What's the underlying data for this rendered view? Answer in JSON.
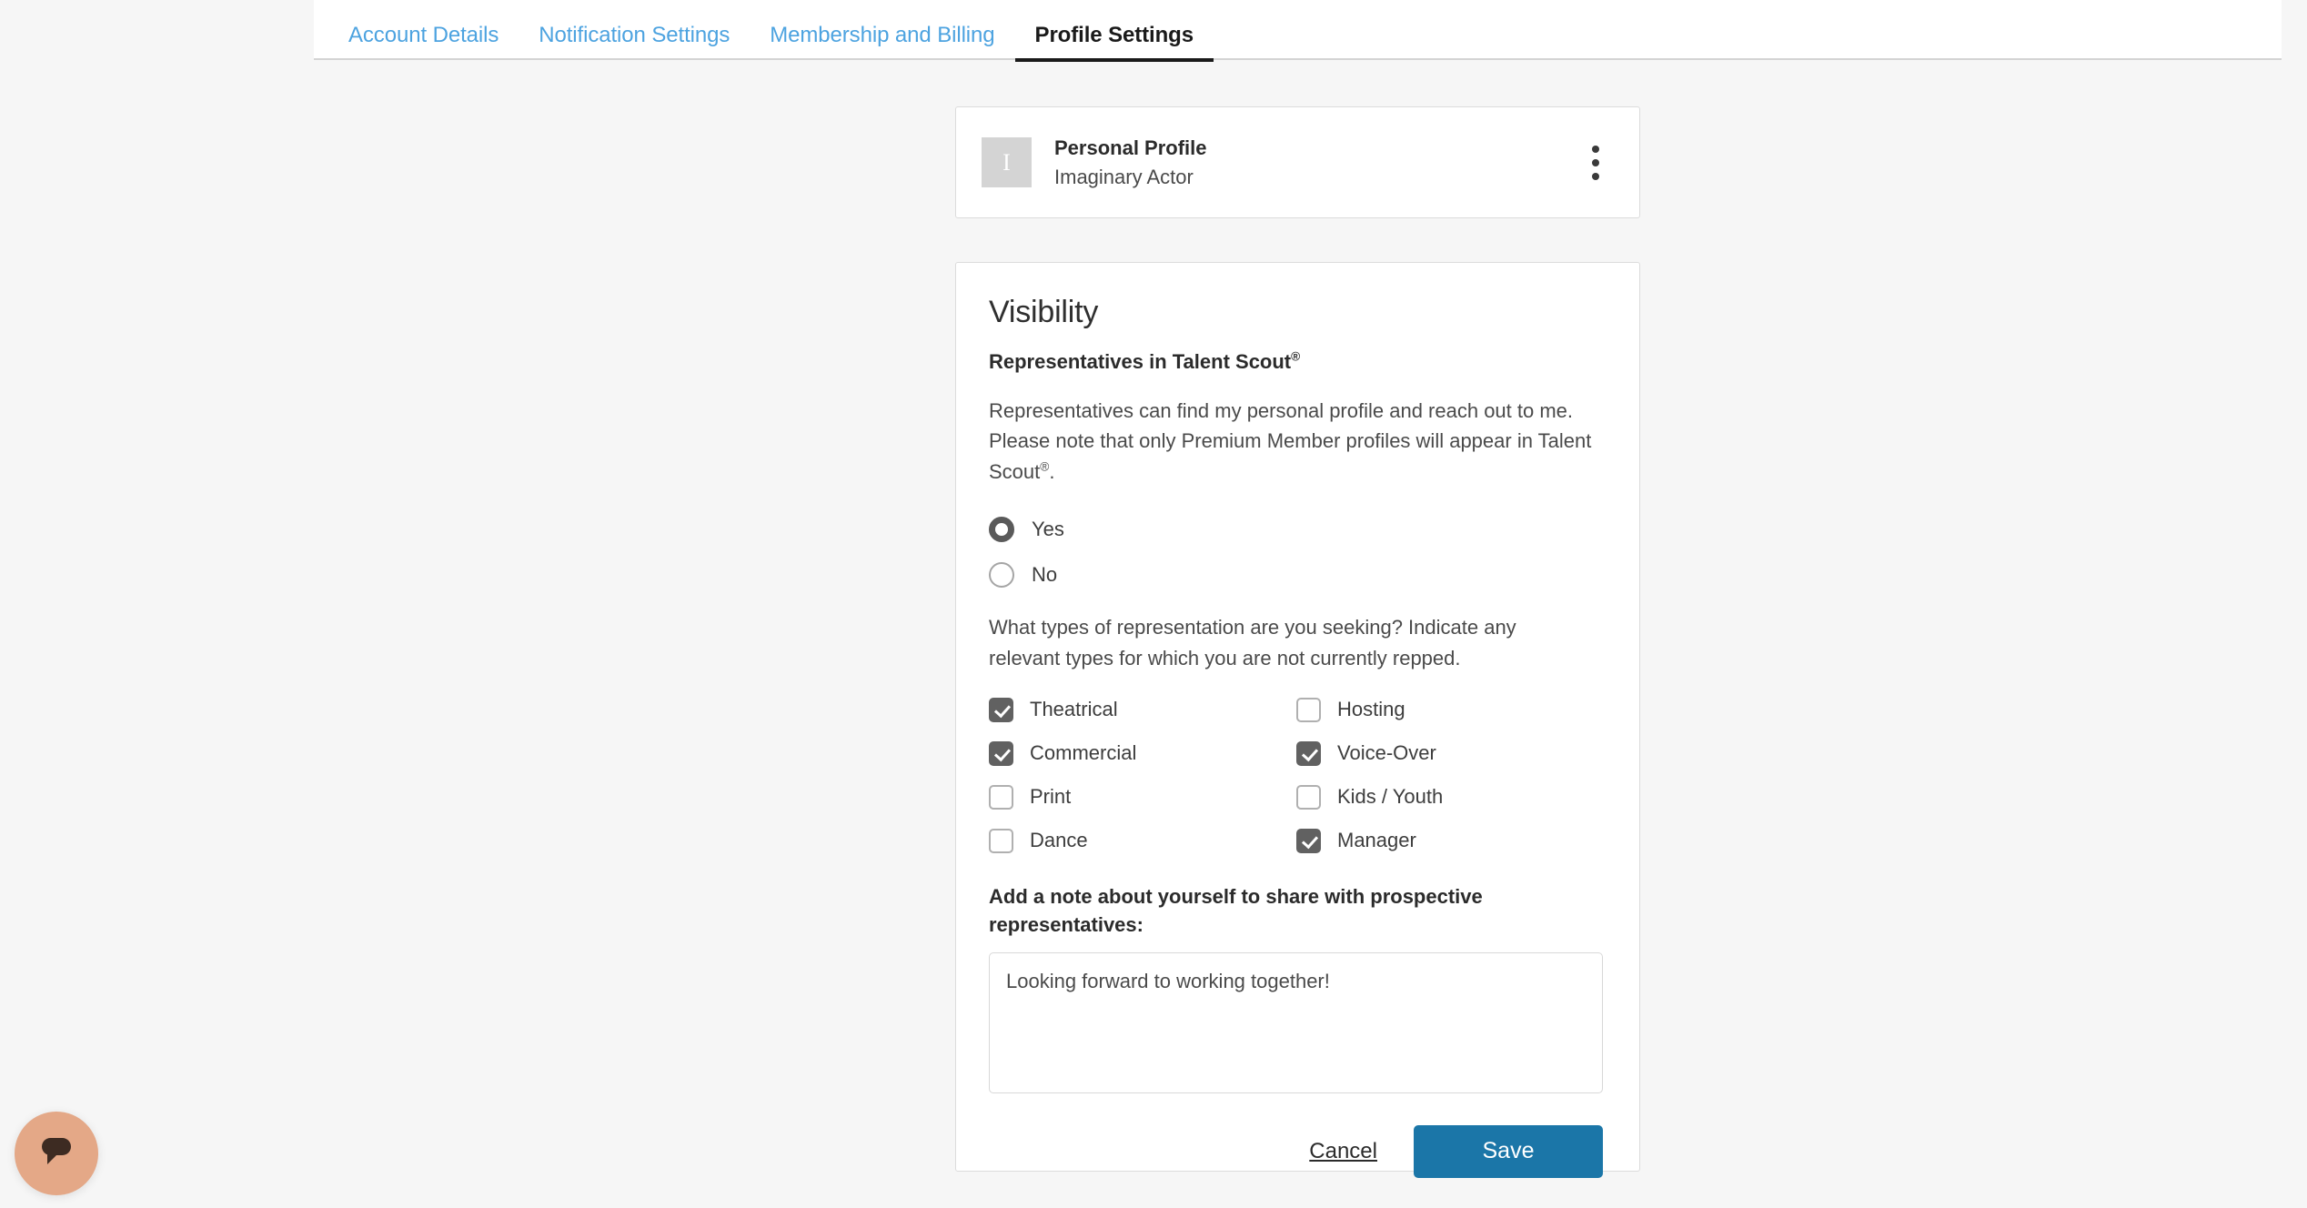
{
  "tabs": [
    {
      "label": "Account Details",
      "active": false
    },
    {
      "label": "Notification Settings",
      "active": false
    },
    {
      "label": "Membership and Billing",
      "active": false
    },
    {
      "label": "Profile Settings",
      "active": true
    }
  ],
  "profile_card": {
    "avatar_initial": "I",
    "title": "Personal Profile",
    "subtitle": "Imaginary Actor",
    "menu_icon": "kebab-menu-icon"
  },
  "visibility": {
    "heading": "Visibility",
    "subheading": "Representatives in Talent Scout",
    "subheading_mark": "®",
    "description_1": "Representatives can find my personal profile and reach out to me. Please note that only Premium Member profiles will appear in Talent Scout",
    "description_2": ".",
    "radios": [
      {
        "label": "Yes",
        "checked": true
      },
      {
        "label": "No",
        "checked": false
      }
    ],
    "types_question": "What types of representation are you seeking? Indicate any relevant types for which you are not currently repped.",
    "checkboxes": [
      {
        "label": "Theatrical",
        "checked": true
      },
      {
        "label": "Hosting",
        "checked": false
      },
      {
        "label": "Commercial",
        "checked": true
      },
      {
        "label": "Voice-Over",
        "checked": true
      },
      {
        "label": "Print",
        "checked": false
      },
      {
        "label": "Kids / Youth",
        "checked": false
      },
      {
        "label": "Dance",
        "checked": false
      },
      {
        "label": "Manager",
        "checked": true
      }
    ],
    "note_label": "Add a note about yourself to share with prospective representatives:",
    "note_value": "Looking forward to working together!",
    "note_placeholder": "",
    "cancel_label": "Cancel",
    "save_label": "Save"
  },
  "chat": {
    "icon": "chat-bubble-icon",
    "bg_color": "#e4a887",
    "glyph_color": "#3d2b22"
  },
  "colors": {
    "page_background": "#f6f6f6",
    "card_background": "#ffffff",
    "tab_link": "#4da3e0",
    "tab_active": "#1a1a1a",
    "save_button": "#1b76a8",
    "control_checked": "#616161"
  }
}
